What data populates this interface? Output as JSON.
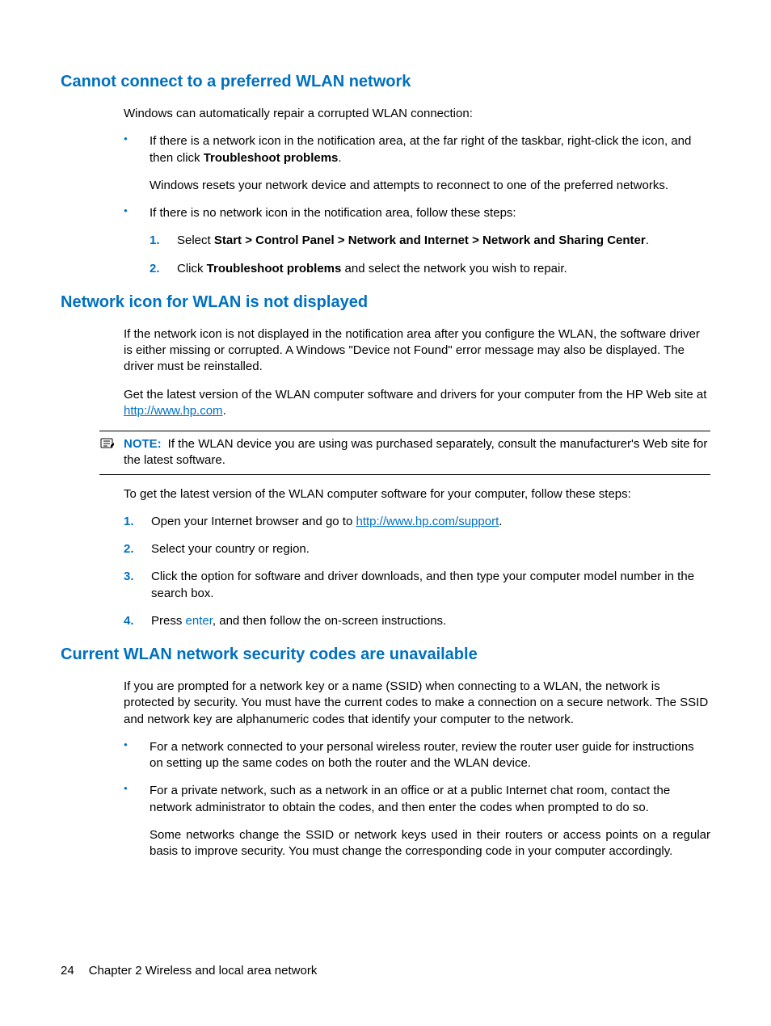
{
  "sections": {
    "s1": {
      "heading": "Cannot connect to a preferred WLAN network",
      "intro": "Windows can automatically repair a corrupted WLAN connection:",
      "bullet1_a": "If there is a network icon in the notification area, at the far right of the taskbar, right-click the icon, and then click ",
      "bullet1_bold": "Troubleshoot problems",
      "bullet1_c": ".",
      "bullet1_sub": "Windows resets your network device and attempts to reconnect to one of the preferred networks.",
      "bullet2": "If there is no network icon in the notification area, follow these steps:",
      "step1_a": "Select ",
      "step1_bold": "Start > Control Panel > Network and Internet > Network and Sharing Center",
      "step1_c": ".",
      "step2_a": "Click ",
      "step2_bold": "Troubleshoot problems",
      "step2_c": " and select the network you wish to repair."
    },
    "s2": {
      "heading": "Network icon for WLAN is not displayed",
      "p1": "If the network icon is not displayed in the notification area after you configure the WLAN, the software driver is either missing or corrupted. A Windows \"Device not Found\" error message may also be displayed. The driver must be reinstalled.",
      "p2_a": "Get the latest version of the WLAN computer software and drivers for your computer from the HP Web site at ",
      "p2_link": "http://www.hp.com",
      "p2_c": ".",
      "note_label": "NOTE:",
      "note_text": "If the WLAN device you are using was purchased separately, consult the manufacturer's Web site for the latest software.",
      "p3": "To get the latest version of the WLAN computer software for your computer, follow these steps:",
      "step1_a": "Open your Internet browser and go to ",
      "step1_link": "http://www.hp.com/support",
      "step1_c": ".",
      "step2": "Select your country or region.",
      "step3": "Click the option for software and driver downloads, and then type your computer model number in the search box.",
      "step4_a": "Press ",
      "step4_key": "enter",
      "step4_c": ", and then follow the on-screen instructions."
    },
    "s3": {
      "heading": "Current WLAN network security codes are unavailable",
      "p1": "If you are prompted for a network key or a name (SSID) when connecting to a WLAN, the network is protected by security. You must have the current codes to make a connection on a secure network. The SSID and network key are alphanumeric codes that identify your computer to the network.",
      "bullet1": "For a network connected to your personal wireless router, review the router user guide for instructions on setting up the same codes on both the router and the WLAN device.",
      "bullet2": "For a private network, such as a network in an office or at a public Internet chat room, contact the network administrator to obtain the codes, and then enter the codes when prompted to do so.",
      "bullet2_sub": "Some networks change the SSID or network keys used in their routers or access points on a regular basis to improve security. You must change the corresponding code in your computer accordingly."
    }
  },
  "footer": {
    "page_number": "24",
    "chapter": "Chapter 2   Wireless and local area network"
  }
}
